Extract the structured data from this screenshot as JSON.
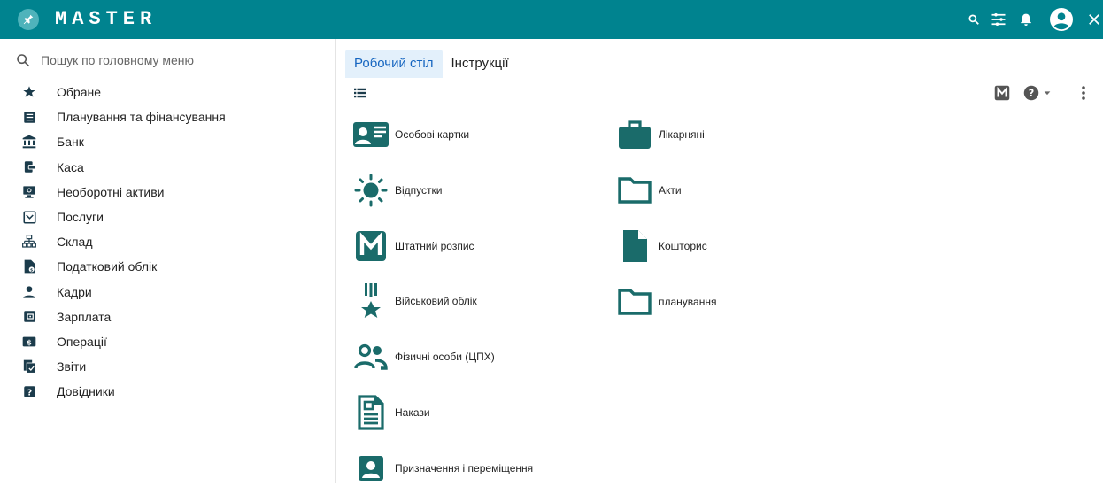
{
  "app": {
    "title": "MASTER"
  },
  "colors": {
    "topbar": "#00838f",
    "icon_teal": "#1a6b6a",
    "tab_active_bg": "#e3f0fb",
    "tab_active_text": "#1565c0"
  },
  "search": {
    "placeholder": "Пошук по головному меню",
    "value": ""
  },
  "sidebar": {
    "items": [
      {
        "label": "Обране",
        "icon": "star-icon"
      },
      {
        "label": "Планування та фінансування",
        "icon": "list-alt-icon"
      },
      {
        "label": "Банк",
        "icon": "bank-icon"
      },
      {
        "label": "Каса",
        "icon": "cash-register-icon"
      },
      {
        "label": "Необоротні активи",
        "icon": "monitor-icon"
      },
      {
        "label": "Послуги",
        "icon": "inbox-icon"
      },
      {
        "label": "Склад",
        "icon": "sitemap-icon"
      },
      {
        "label": "Податковий облік",
        "icon": "tax-file-icon"
      },
      {
        "label": "Кадри",
        "icon": "person-icon"
      },
      {
        "label": "Зарплата",
        "icon": "wallet-icon"
      },
      {
        "label": "Операції",
        "icon": "dollar-box-icon"
      },
      {
        "label": "Звіти",
        "icon": "report-check-icon"
      },
      {
        "label": "Довідники",
        "icon": "help-box-icon"
      }
    ]
  },
  "tabs": [
    {
      "label": "Робочий стіл",
      "active": true
    },
    {
      "label": "Інструкції",
      "active": false
    }
  ],
  "tiles": {
    "left": [
      {
        "label": "Особові картки",
        "icon": "id-card-icon"
      },
      {
        "label": "Відпустки",
        "icon": "sun-icon"
      },
      {
        "label": "Штатний розпис",
        "icon": "m-logo-icon"
      },
      {
        "label": "Військовий облік",
        "icon": "medal-icon"
      },
      {
        "label": "Фізичні особи (ЦПХ)",
        "icon": "people-icon"
      },
      {
        "label": "Накази",
        "icon": "document-icon"
      },
      {
        "label": "Призначення і переміщення",
        "icon": "account-box-icon"
      }
    ],
    "right": [
      {
        "label": "Лікарняні",
        "icon": "briefcase-icon"
      },
      {
        "label": "Акти",
        "icon": "folder-outline-icon"
      },
      {
        "label": "Кошторис",
        "icon": "file-icon"
      },
      {
        "label": "планування",
        "icon": "folder-outline-icon"
      }
    ]
  }
}
